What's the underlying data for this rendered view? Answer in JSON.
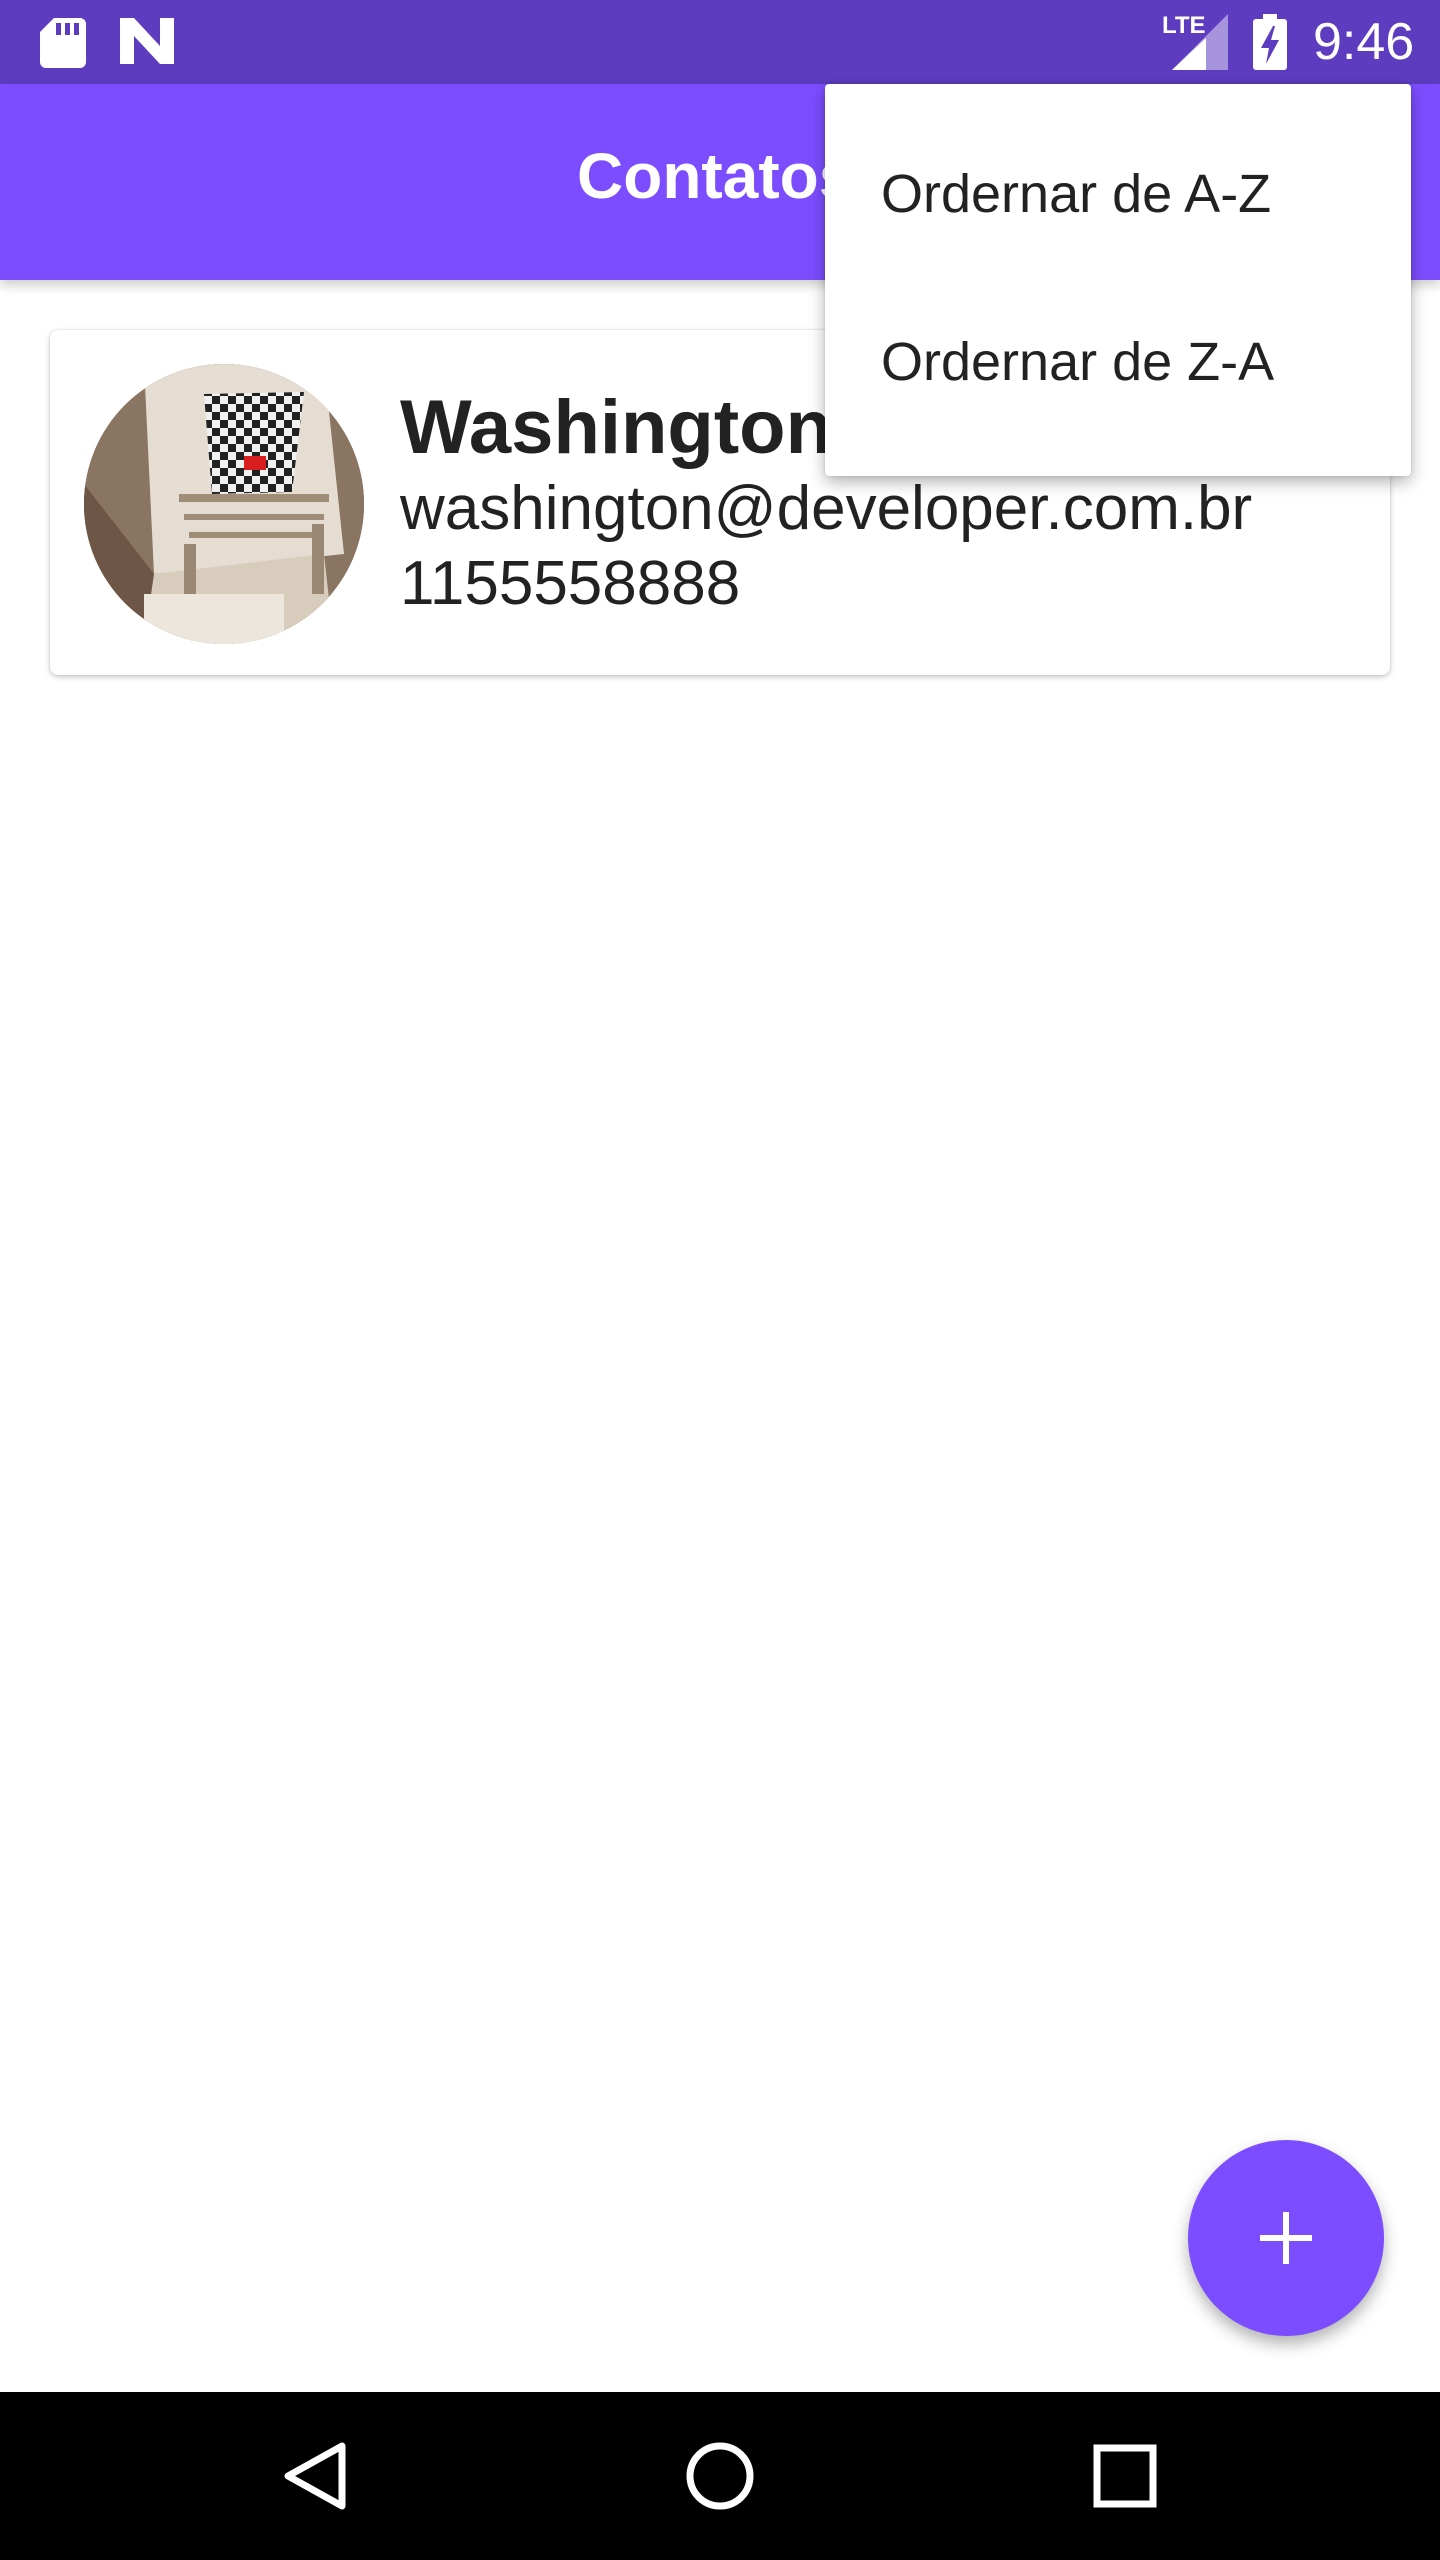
{
  "status_bar": {
    "time": "9:46",
    "network_label": "LTE",
    "icons": [
      "sd-card-icon",
      "n-logo-icon",
      "signal-icon",
      "battery-charging-icon"
    ]
  },
  "app_bar": {
    "title": "Contatos"
  },
  "contacts": [
    {
      "name": "Washington",
      "email": "washington@developer.com.br",
      "phone": "1155558888"
    }
  ],
  "overflow_menu": {
    "items": [
      {
        "label": "Ordernar de A-Z"
      },
      {
        "label": "Ordernar de Z-A"
      }
    ]
  },
  "fab": {
    "icon": "plus-icon"
  },
  "nav_bar": {
    "icons": [
      "back-icon",
      "home-icon",
      "recents-icon"
    ]
  },
  "colors": {
    "status_bar": "#5e3cc0",
    "primary": "#7c4dff",
    "text": "#222222"
  }
}
